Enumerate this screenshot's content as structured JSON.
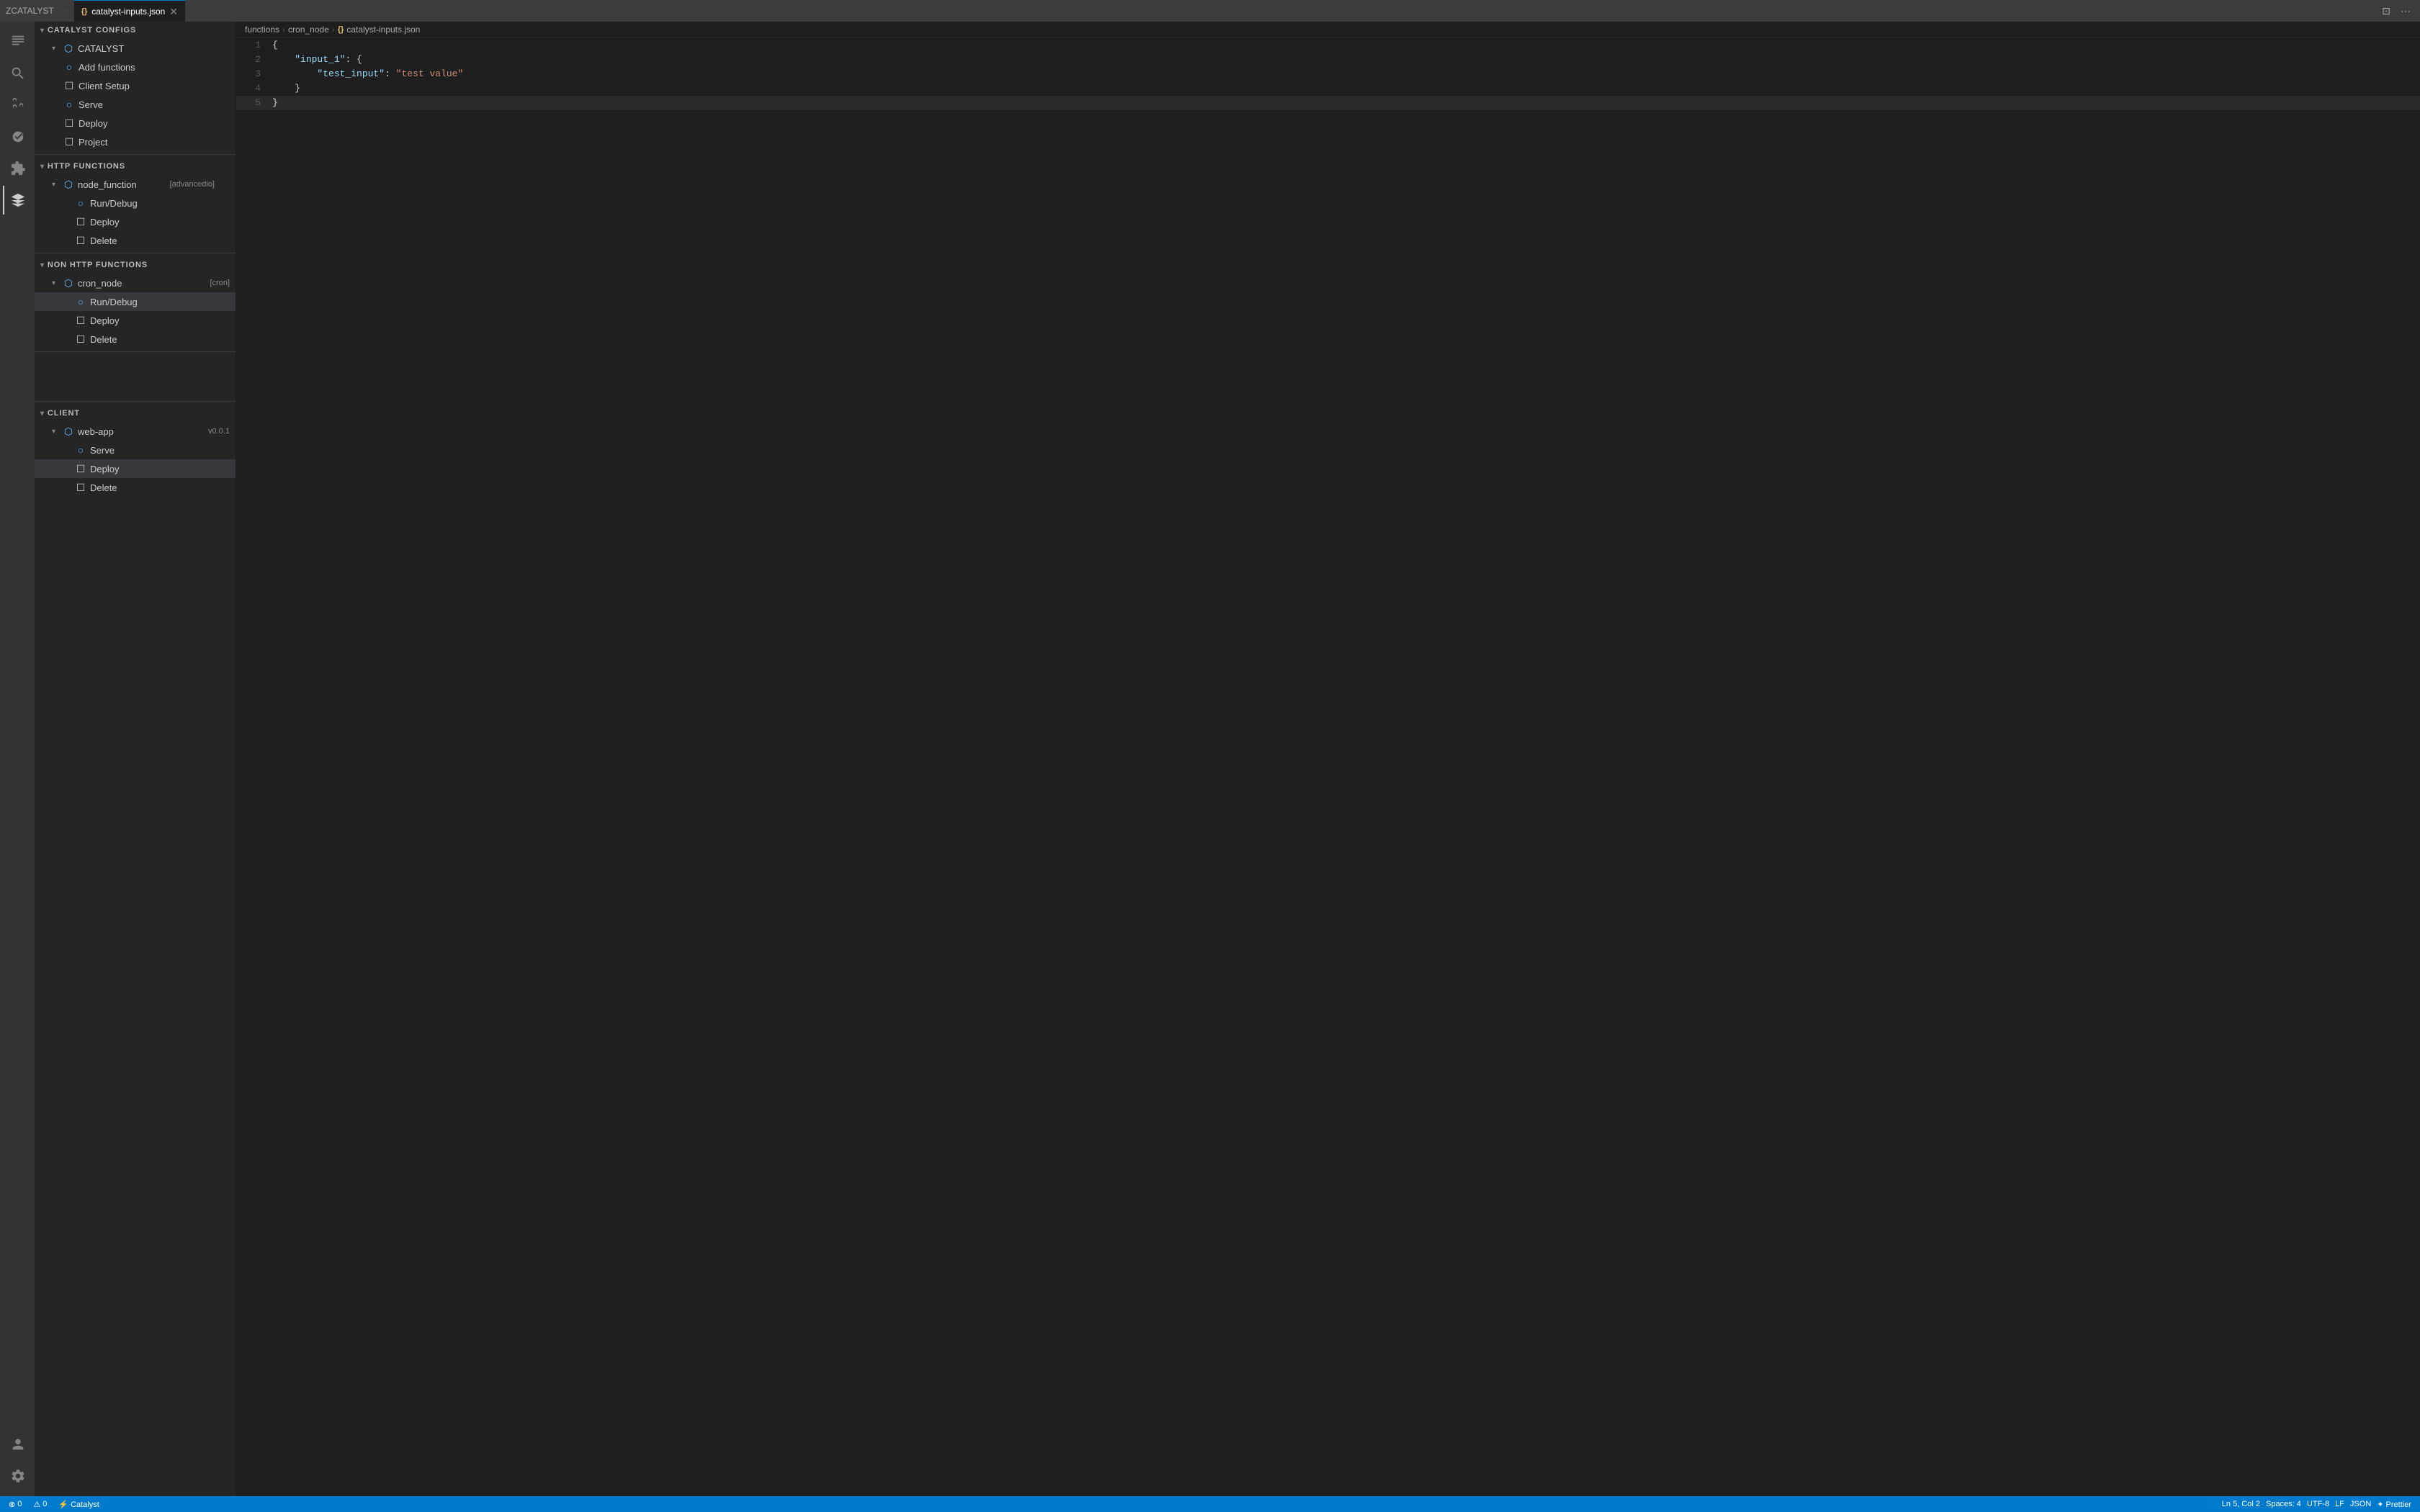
{
  "titleBar": {
    "tabName": "ZCATALYST",
    "tabMore": "···",
    "fileTab": {
      "label": "catalyst-inputs.json",
      "icon": "{}",
      "active": true
    },
    "windowControls": [
      "⊡",
      "···"
    ]
  },
  "breadcrumb": {
    "parts": [
      "functions",
      "cron_node",
      "{} catalyst-inputs.json"
    ]
  },
  "sidebar": {
    "topSection": "CATALYST CONFIGS",
    "catalystGroup": {
      "label": "CATALYST",
      "items": [
        {
          "id": "add-functions",
          "label": "Add functions",
          "icon": "○",
          "indent": 2
        },
        {
          "id": "client-setup",
          "label": "Client Setup",
          "icon": "☐",
          "indent": 2
        },
        {
          "id": "serve",
          "label": "Serve",
          "icon": "○",
          "indent": 2
        },
        {
          "id": "deploy",
          "label": "Deploy",
          "icon": "☐",
          "indent": 2
        },
        {
          "id": "project",
          "label": "Project",
          "icon": "☐",
          "indent": 2
        }
      ]
    },
    "httpSection": {
      "label": "HTTP FUNCTIONS",
      "groups": [
        {
          "id": "node-function",
          "label": "node_function",
          "badge": "[advancedio]",
          "items": [
            {
              "id": "run-debug-http",
              "label": "Run/Debug",
              "icon": "○",
              "indent": 3
            },
            {
              "id": "deploy-http",
              "label": "Deploy",
              "icon": "☐",
              "indent": 3
            },
            {
              "id": "delete-http",
              "label": "Delete",
              "icon": "☐",
              "indent": 3
            }
          ]
        }
      ]
    },
    "nonHttpSection": {
      "label": "NON HTTP FUNCTIONS",
      "groups": [
        {
          "id": "cron-node",
          "label": "cron_node",
          "badge": "[cron]",
          "items": [
            {
              "id": "run-debug-cron",
              "label": "Run/Debug",
              "icon": "○",
              "indent": 3,
              "active": true
            },
            {
              "id": "deploy-cron",
              "label": "Deploy",
              "icon": "☐",
              "indent": 3
            },
            {
              "id": "delete-cron",
              "label": "Delete",
              "icon": "☐",
              "indent": 3
            }
          ]
        }
      ]
    },
    "clientSection": {
      "label": "CLIENT",
      "groups": [
        {
          "id": "web-app",
          "label": "web-app",
          "badge": "v0.0.1",
          "items": [
            {
              "id": "serve-client",
              "label": "Serve",
              "icon": "○",
              "indent": 3
            },
            {
              "id": "deploy-client",
              "label": "Deploy",
              "icon": "☐",
              "indent": 3,
              "active": true
            },
            {
              "id": "delete-client",
              "label": "Delete",
              "icon": "☐",
              "indent": 3
            }
          ]
        }
      ]
    }
  },
  "editor": {
    "lines": [
      {
        "num": 1,
        "content": "{"
      },
      {
        "num": 2,
        "content": "    \"input_1\": {"
      },
      {
        "num": 3,
        "content": "        \"test_input\": \"test value\""
      },
      {
        "num": 4,
        "content": "    }"
      },
      {
        "num": 5,
        "content": "}",
        "cursor": true
      }
    ]
  },
  "statusBar": {
    "left": [
      {
        "id": "errors",
        "icon": "⊗",
        "count": "0"
      },
      {
        "id": "warnings",
        "icon": "⚠",
        "count": "0"
      }
    ],
    "catalyst": "⚡ Catalyst",
    "right": [
      {
        "id": "position",
        "label": "Ln 5, Col 2"
      },
      {
        "id": "spaces",
        "label": "Spaces: 4"
      },
      {
        "id": "encoding",
        "label": "UTF-8"
      },
      {
        "id": "eol",
        "label": "LF"
      },
      {
        "id": "language",
        "label": "JSON"
      },
      {
        "id": "prettier",
        "label": "✦ Prettier"
      }
    ]
  }
}
